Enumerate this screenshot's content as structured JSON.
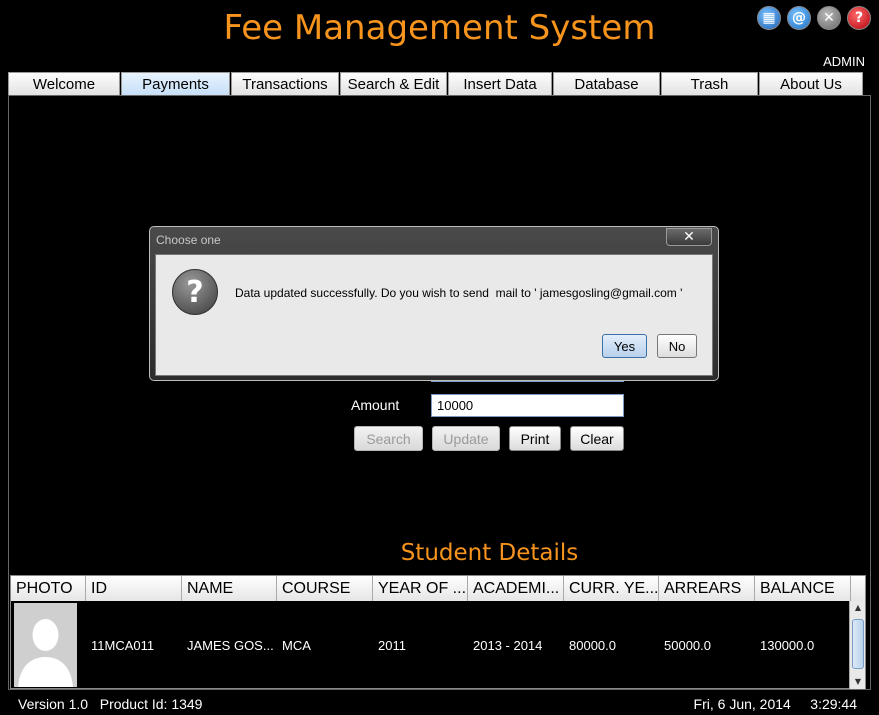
{
  "app": {
    "title": "Fee Management System",
    "user": "ADMIN"
  },
  "top_icons": [
    {
      "name": "apps-icon",
      "glyph": "▦"
    },
    {
      "name": "mail-icon",
      "glyph": "@"
    },
    {
      "name": "close-icon",
      "glyph": "✕"
    },
    {
      "name": "help-icon",
      "glyph": "?"
    }
  ],
  "tabs": [
    {
      "label": "Welcome",
      "width": 112
    },
    {
      "label": "Payments",
      "width": 109,
      "active": true
    },
    {
      "label": "Transactions",
      "width": 108
    },
    {
      "label": "Search & Edit",
      "width": 107
    },
    {
      "label": "Insert Data",
      "width": 104
    },
    {
      "label": "Database",
      "width": 107
    },
    {
      "label": "Trash",
      "width": 97
    },
    {
      "label": "About Us",
      "width": 104
    }
  ],
  "tab_labels": {
    "welcome": "Welcome",
    "payments": "Payments",
    "transactions": "Transactions",
    "search_edit": "Search & Edit",
    "insert_data": "Insert Data",
    "database": "Database",
    "trash": "Trash",
    "about_us": "About Us"
  },
  "form": {
    "amount_label": "Amount",
    "amount_value": "10000",
    "search_label": "Search",
    "update_label": "Update",
    "print_label": "Print",
    "clear_label": "Clear"
  },
  "student_details": {
    "title": "Student Details",
    "columns": [
      "PHOTO",
      "ID",
      "NAME",
      "COURSE",
      "YEAR OF ...",
      "ACADEMI...",
      "CURR. YE...",
      "ARREARS",
      "BALANCE"
    ],
    "row": {
      "id": "11MCA011",
      "name": "JAMES GOS...",
      "course": "MCA",
      "year_of_admission": "2011",
      "academic_year": "2013 - 2014",
      "current_year_fee": "80000.0",
      "arrears": "50000.0",
      "balance": "130000.0"
    }
  },
  "status": {
    "version": "Version 1.0",
    "product_id": "Product Id: 1349",
    "date": "Fri, 6 Jun, 2014",
    "time": "3:29:44"
  },
  "dialog": {
    "title": "Choose one",
    "message": "Data updated successfully. Do you wish to send  mail to ' jamesgosling@gmail.com '",
    "yes_label": "Yes",
    "no_label": "No"
  }
}
